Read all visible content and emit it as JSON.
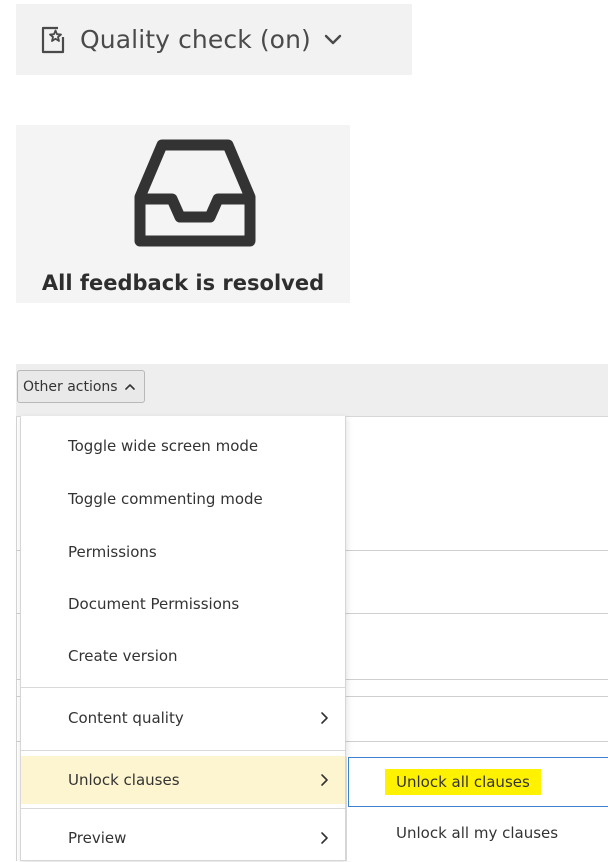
{
  "quality_check": {
    "label": "Quality check (on)",
    "icon": "document-star-icon"
  },
  "feedback": {
    "message": "All feedback is resolved",
    "icon": "inbox-tray-icon"
  },
  "toolbar": {
    "other_actions_label": "Other actions"
  },
  "menu": {
    "items": [
      {
        "label": "Toggle wide screen mode"
      },
      {
        "label": "Toggle commenting mode"
      },
      {
        "label": "Permissions"
      },
      {
        "label": "Document Permissions"
      },
      {
        "label": "Create version"
      },
      {
        "label": "Content quality",
        "has_submenu": true
      },
      {
        "label": "Unlock clauses",
        "has_submenu": true,
        "highlighted": true
      },
      {
        "label": "Preview",
        "has_submenu": true
      }
    ]
  },
  "submenu": {
    "items": [
      {
        "label": "Unlock all clauses",
        "highlighted": true
      },
      {
        "label": "Unlock all my clauses"
      }
    ]
  },
  "colors": {
    "highlight_row": "#fdf5cf",
    "highlight_text": "#fff200",
    "focus_border": "#3d7fd1"
  }
}
